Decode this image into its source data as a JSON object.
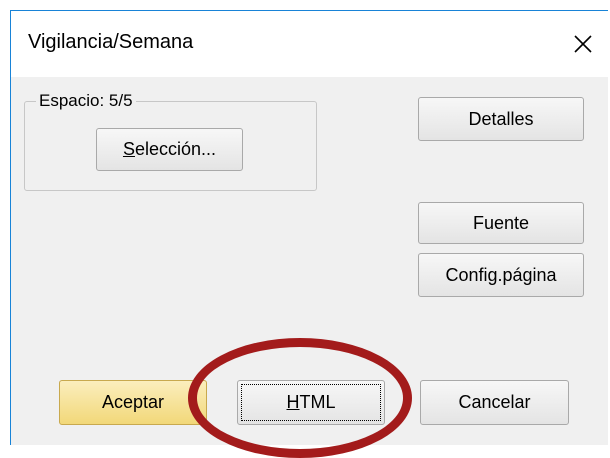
{
  "window": {
    "title": "Vigilancia/Semana"
  },
  "group": {
    "legend": "Espacio: 5/5",
    "selection_button": {
      "mnemonic": "S",
      "rest": "elección..."
    }
  },
  "buttons": {
    "details": "Detalles",
    "font": "Fuente",
    "page_setup": "Config.página",
    "accept": "Aceptar",
    "html": {
      "mnemonic": "H",
      "rest": "TML"
    },
    "cancel": "Cancelar"
  },
  "icons": {
    "close": "close-icon"
  },
  "colors": {
    "accent_border": "#1883d7",
    "default_button": "#f2d879",
    "highlight": "#a31b1b"
  }
}
